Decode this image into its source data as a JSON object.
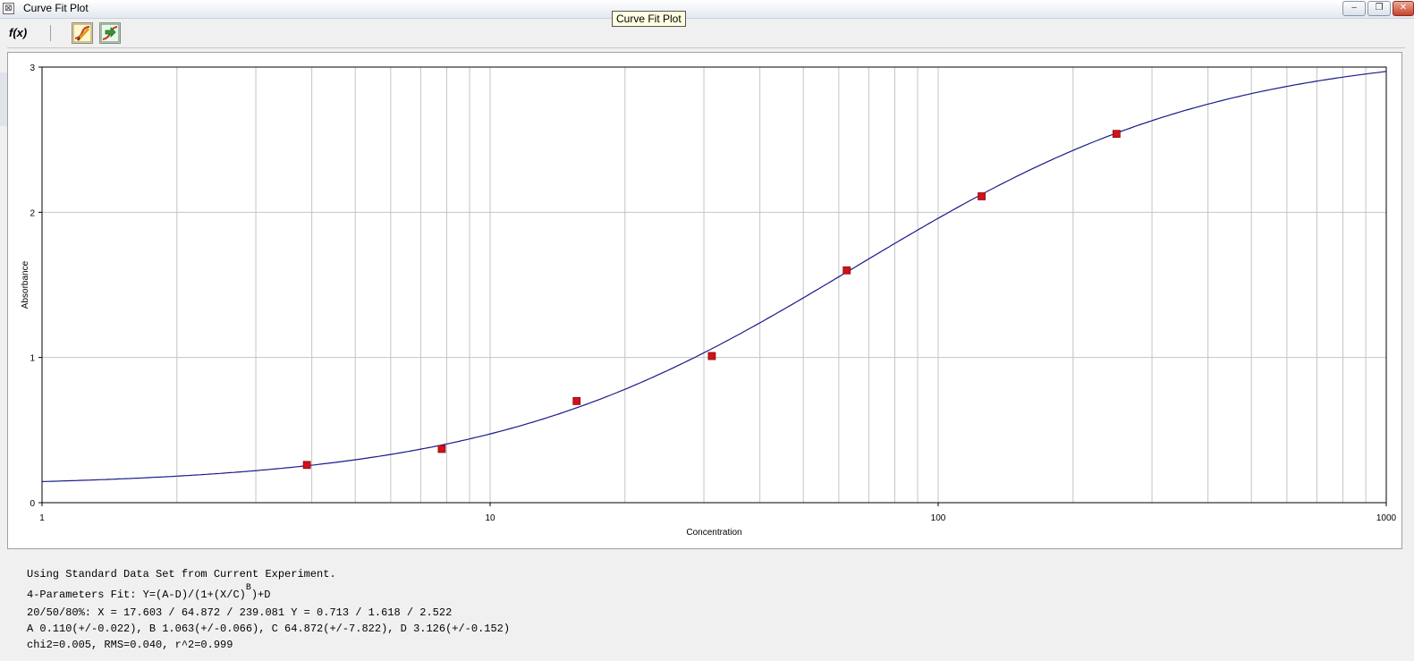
{
  "window": {
    "title": "Curve Fit Plot",
    "tooltip": "Curve Fit Plot",
    "minimize_glyph": "‒",
    "restore_glyph": "❐",
    "close_glyph": "✕",
    "app_icon_glyph": "⊠"
  },
  "toolbar": {
    "fx_label": "f(x)",
    "icons": [
      "curve-fit-edit-icon",
      "curve-fit-export-icon"
    ]
  },
  "colors": {
    "curve": "#1a1a8c",
    "points": "#d0121b",
    "grid": "#c4c4c4",
    "axis": "#000000"
  },
  "chart_data": {
    "type": "scatter",
    "xlabel": "Concentration",
    "ylabel": "Absorbance",
    "x_scale": "log",
    "xlim": [
      1,
      1000
    ],
    "ylim": [
      0,
      3
    ],
    "x_ticks": [
      1,
      10,
      100,
      1000
    ],
    "x_tick_labels": [
      "1",
      "10",
      "100",
      "1000"
    ],
    "y_ticks": [
      0,
      1,
      2,
      3
    ],
    "y_tick_labels": [
      "0",
      "1",
      "2",
      "3"
    ],
    "grid": true,
    "series": [
      {
        "kind": "points",
        "x": [
          3.9,
          7.8,
          15.6,
          31.25,
          62.5,
          125,
          250
        ],
        "y": [
          0.26,
          0.37,
          0.7,
          1.01,
          1.6,
          2.11,
          2.54
        ]
      },
      {
        "kind": "fit-curve",
        "model": "4PL",
        "params": {
          "A": 0.11,
          "B": 1.063,
          "C": 64.872,
          "D": 3.126
        }
      }
    ]
  },
  "results": {
    "line1": "Using Standard Data Set from Current Experiment.",
    "line2_prefix": "4-Parameters Fit: Y=(A-D)/(1+(X/C)",
    "line2_sup": "B",
    "line2_suffix": ")+D",
    "line3": "20/50/80%: X = 17.603 / 64.872 / 239.081 Y = 0.713 / 1.618 / 2.522",
    "line4": "A 0.110(+/-0.022), B 1.063(+/-0.066), C 64.872(+/-7.822), D 3.126(+/-0.152)",
    "line5": "chi2=0.005, RMS=0.040, r^2=0.999"
  }
}
